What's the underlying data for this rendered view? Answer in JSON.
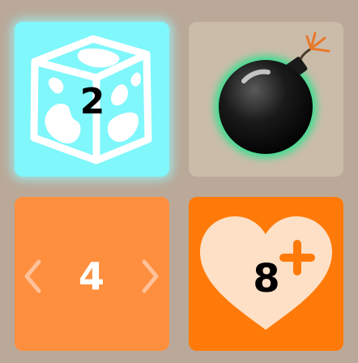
{
  "tiles": {
    "ice": {
      "icon": "ice-cube-icon",
      "count": "2",
      "color": "#7ff7fb"
    },
    "bomb": {
      "icon": "bomb-icon",
      "color": "#cbbcaa",
      "glow": "#35e08e"
    },
    "stepper": {
      "value": "4",
      "color": "#fe8f3f"
    },
    "heart": {
      "icon": "heart-plus-icon",
      "count": "8",
      "color": "#ff7a08"
    }
  },
  "background": "#baa999"
}
